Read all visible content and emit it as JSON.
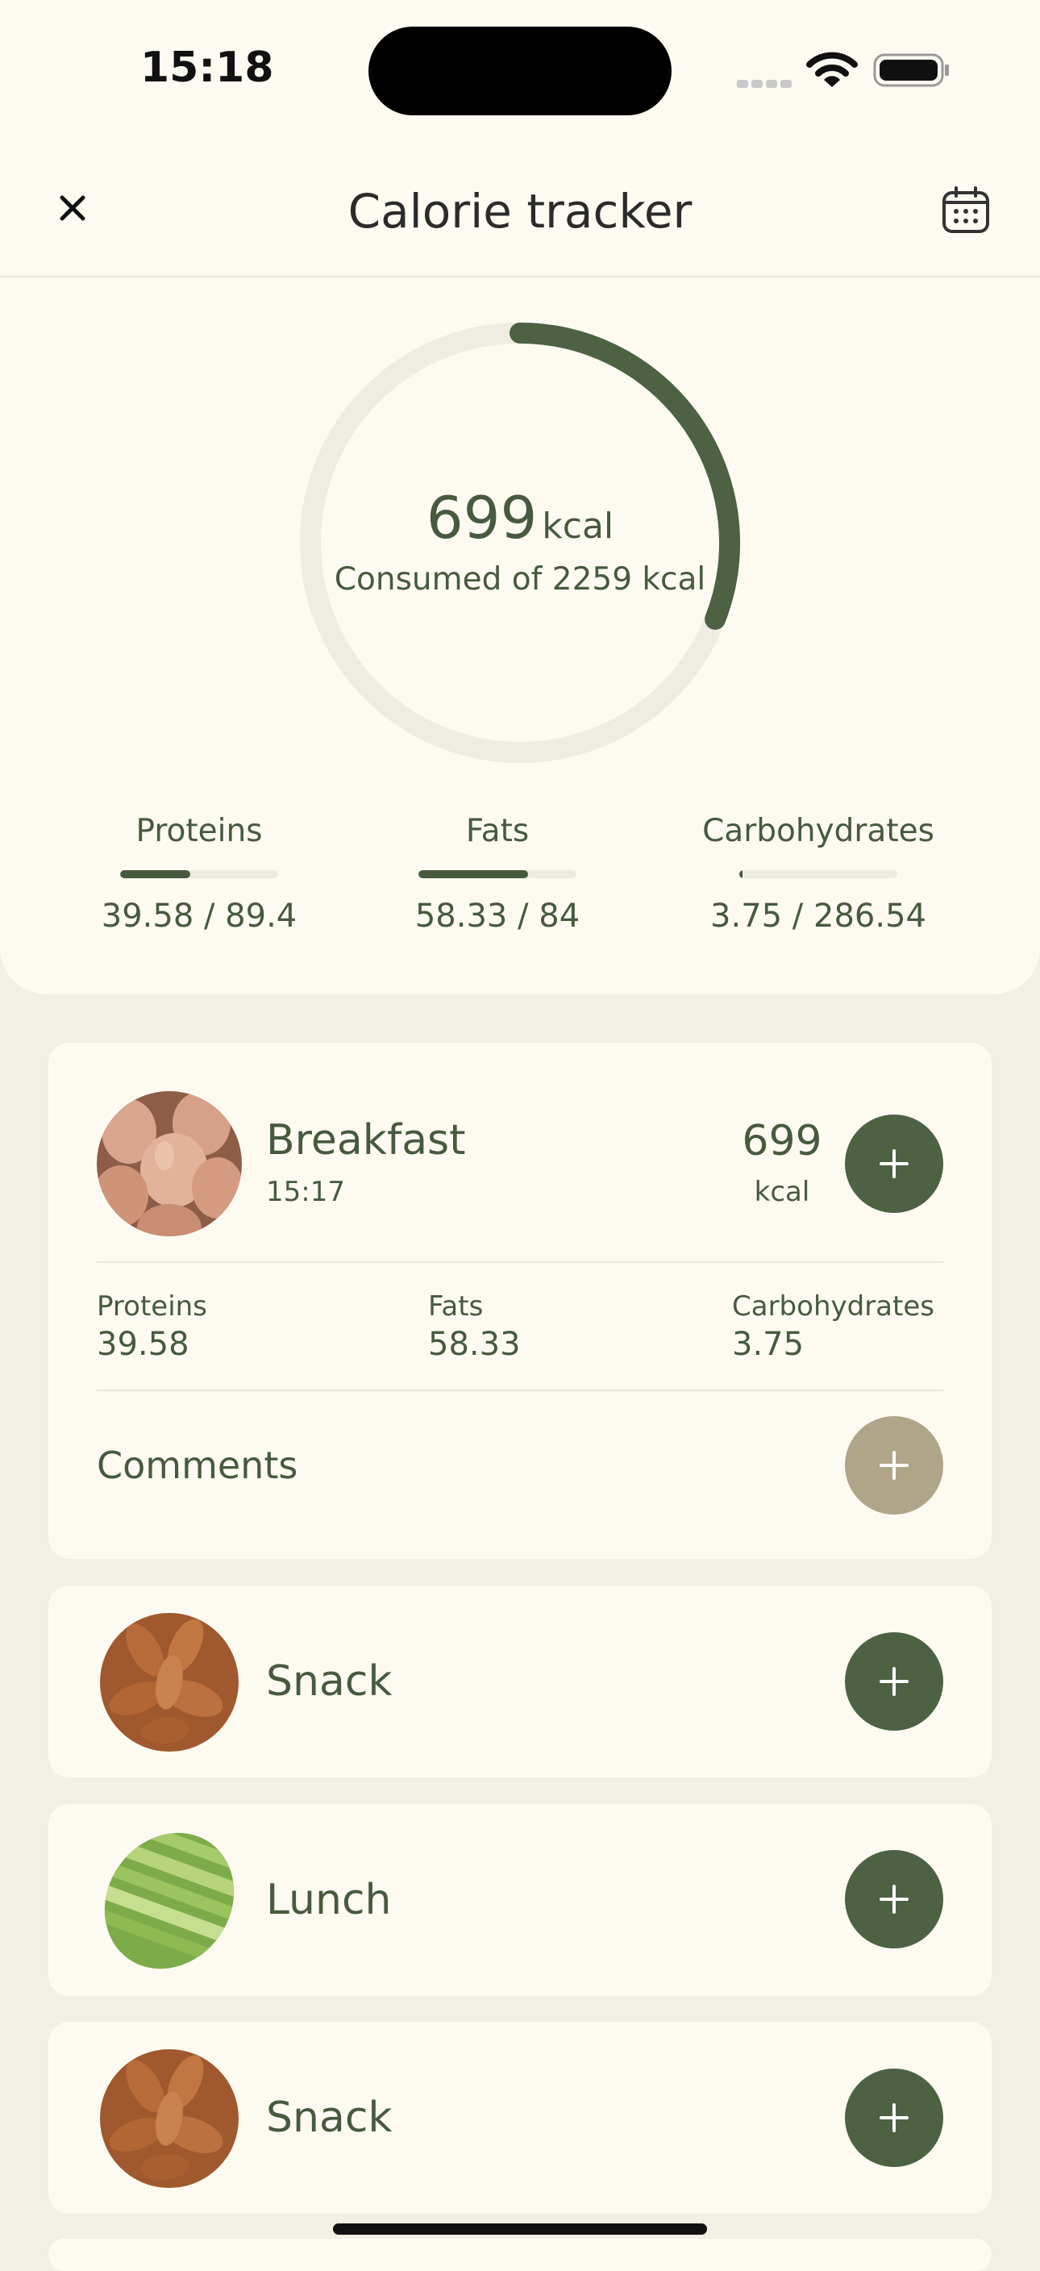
{
  "status_bar": {
    "time": "15:18"
  },
  "header": {
    "title": "Calorie tracker",
    "close_icon": "close-icon",
    "calendar_icon": "calendar-icon"
  },
  "calories": {
    "consumed": "699",
    "unit": "kcal",
    "subtitle": "Consumed of 2259 kcal",
    "consumed_value": 699,
    "goal_value": 2259
  },
  "macros": [
    {
      "label": "Proteins",
      "value": "39.58 / 89.4",
      "fraction": 0.443
    },
    {
      "label": "Fats",
      "value": "58.33 / 84",
      "fraction": 0.694
    },
    {
      "label": "Carbohydrates",
      "value": "3.75 / 286.54",
      "fraction": 0.013
    }
  ],
  "meals": [
    {
      "name": "Breakfast",
      "time": "15:17",
      "kcal": "699",
      "kcal_unit": "kcal",
      "macros": [
        {
          "label": "Proteins",
          "value": "39.58"
        },
        {
          "label": "Fats",
          "value": "58.33"
        },
        {
          "label": "Carbohydrates",
          "value": "3.75"
        }
      ],
      "comments_label": "Comments"
    },
    {
      "name": "Snack"
    },
    {
      "name": "Lunch"
    },
    {
      "name": "Snack"
    }
  ],
  "colors": {
    "accent": "#4d6143",
    "accent_light": "#b0a589",
    "background": "#f2f0e4",
    "surface": "#fdfbf1"
  }
}
